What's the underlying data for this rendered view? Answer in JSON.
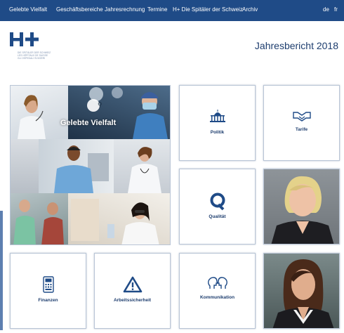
{
  "nav": {
    "items": [
      "Gelebte Vielfalt",
      "Geschäftsbereiche",
      "Jahresrechnung",
      "Termine",
      "H+ Die Spitäler der Schweiz",
      "Archiv"
    ],
    "lang_de": "de",
    "lang_fr": "fr"
  },
  "header": {
    "logo_text": "H+",
    "tagline": [
      "DIE SPITÄLER DER SCHWEIZ",
      "LES HÔPITAUX DE SUISSE",
      "GLI OSPEDALI SVIZZERI"
    ],
    "report_title": "Jahresbericht 2018"
  },
  "collage": {
    "title": "Gelebte Vielfalt"
  },
  "tiles": {
    "politik": "Politik",
    "tarife": "Tarife",
    "qualitaet": "Qualität",
    "finanzen": "Finanzen",
    "arbeitssicherheit": "Arbeitssicherheit",
    "kommunikation": "Kommunikation"
  },
  "colors": {
    "brand_blue": "#1f4b87",
    "text_blue": "#1d3d6e",
    "tile_border": "#b9c5d6"
  },
  "icons": {
    "politik": "parliament-icon",
    "tarife": "handshake-icon",
    "qualitaet": "q-letter-icon",
    "finanzen": "payment-terminal-icon",
    "arbeitssicherheit": "warning-triangle-icon",
    "kommunikation": "speech-heads-icon"
  }
}
